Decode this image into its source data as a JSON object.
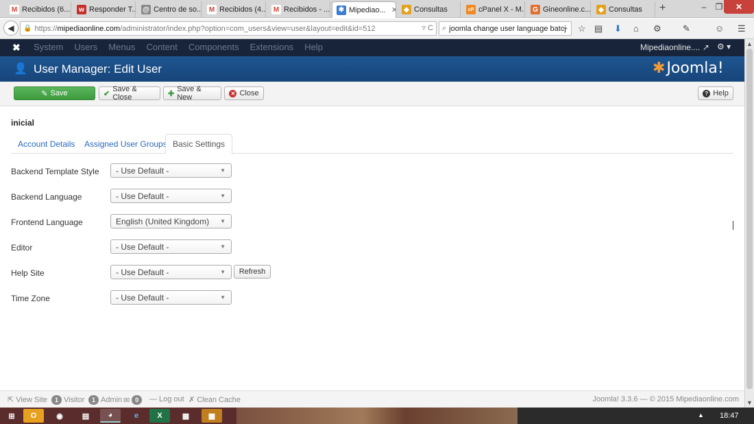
{
  "browser": {
    "tabs": [
      {
        "title": "Recibidos (6...",
        "icon": "gmail-icon",
        "color": "#d44638",
        "glyph": "M"
      },
      {
        "title": "Responder T...",
        "icon": "outlook-icon",
        "color": "#c4302b",
        "glyph": "w"
      },
      {
        "title": "Centro de so...",
        "icon": "support-icon",
        "color": "#8a8a8a",
        "glyph": "@"
      },
      {
        "title": "Recibidos (4...",
        "icon": "gmail-icon",
        "color": "#d44638",
        "glyph": "M"
      },
      {
        "title": "Recibidos - ...",
        "icon": "gmail-icon",
        "color": "#d44638",
        "glyph": "M"
      },
      {
        "title": "Mipediao...",
        "icon": "joomla-icon",
        "color": "#3a7bd5",
        "glyph": "✱",
        "active": true
      },
      {
        "title": "Consultas",
        "icon": "consultas-icon",
        "color": "#e4a020",
        "glyph": "◆"
      },
      {
        "title": "cPanel X - M...",
        "icon": "cpanel-icon",
        "color": "#f08a24",
        "glyph": "cP"
      },
      {
        "title": "Gineonline.c...",
        "icon": "gineonline-icon",
        "color": "#e07030",
        "glyph": "G"
      },
      {
        "title": "Consultas",
        "icon": "consultas-icon",
        "color": "#e4a020",
        "glyph": "◆"
      }
    ],
    "url_prefix": "https://",
    "url_host": "mipediaonline.com",
    "url_path": "/administrator/index.php?option=com_users&view=user&layout=edit&id=512",
    "search_value": "joomla change user language batcj"
  },
  "adminbar": {
    "menu": [
      "System",
      "Users",
      "Menus",
      "Content",
      "Components",
      "Extensions",
      "Help"
    ],
    "site_label": "Mipediaonline....",
    "site_link_icon": "external-link-icon",
    "settings_icon": "gear-icon"
  },
  "header": {
    "title": "User Manager: Edit User",
    "brand": "Joomla!"
  },
  "toolbar": {
    "save_label": "Save",
    "save_close_label": "Save & Close",
    "save_new_label": "Save & New",
    "close_label": "Close",
    "help_label": "Help"
  },
  "user": {
    "username": "inicial"
  },
  "tabs": {
    "account_details": "Account Details",
    "assigned_groups": "Assigned User Groups",
    "basic_settings": "Basic Settings"
  },
  "settings": {
    "backend_template_label": "Backend Template Style",
    "backend_template_value": "- Use Default -",
    "backend_language_label": "Backend Language",
    "backend_language_value": "- Use Default -",
    "frontend_language_label": "Frontend Language",
    "frontend_language_value": "English (United Kingdom)",
    "editor_label": "Editor",
    "editor_value": "- Use Default -",
    "help_site_label": "Help Site",
    "help_site_value": "- Use Default -",
    "refresh_label": "Refresh",
    "timezone_label": "Time Zone",
    "timezone_value": "- Use Default -"
  },
  "statusbar": {
    "view_site": "View Site",
    "visitor_count": "1",
    "visitor_label": "Visitor",
    "admin_count": "1",
    "admin_label": "Admin",
    "messages_count": "0",
    "logout_label": "Log out",
    "clean_cache_label": "Clean Cache",
    "footer": "Joomla! 3.3.6 — © 2015 Mipediaonline.com"
  },
  "taskbar": {
    "clock": "18:47"
  }
}
